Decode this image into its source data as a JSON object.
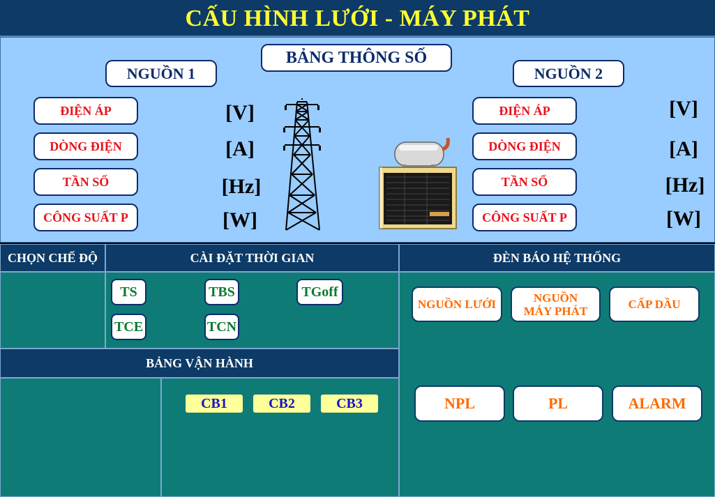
{
  "title": "CẤU HÌNH LƯỚI - MÁY PHÁT",
  "params": {
    "header": "BẢNG THÔNG SỐ",
    "source1": {
      "label": "NGUỒN 1",
      "rows": [
        {
          "name": "ĐIỆN ÁP",
          "unit": "[V]"
        },
        {
          "name": "DÒNG ĐIỆN",
          "unit": "[A]"
        },
        {
          "name": "TẦN SỐ",
          "unit": "[Hz]"
        },
        {
          "name": "CÔNG SUẤT P",
          "unit": "[W]"
        }
      ]
    },
    "source2": {
      "label": "NGUỒN 2",
      "rows": [
        {
          "name": "ĐIỆN ÁP",
          "unit": "[V]"
        },
        {
          "name": "DÒNG ĐIỆN",
          "unit": "[A]"
        },
        {
          "name": "TẦN SỐ",
          "unit": "[Hz]"
        },
        {
          "name": "CÔNG SUẤT P",
          "unit": "[W]"
        }
      ]
    },
    "icons": [
      "transmission-tower-icon",
      "generator-icon"
    ]
  },
  "mode": {
    "header": "CHỌN CHẾ ĐỘ"
  },
  "time_settings": {
    "header": "CÀI ĐẶT THỜI GIAN",
    "buttons": [
      "TS",
      "TBS",
      "TGoff",
      "TCE",
      "TCN"
    ]
  },
  "operation": {
    "header": "BẢNG VẬN HÀNH",
    "breakers": [
      "CB1",
      "CB2",
      "CB3"
    ]
  },
  "indicators": {
    "header": "ĐÈN BÁO HỆ THỐNG",
    "row1": [
      {
        "line1": "NGUỒN LƯỚI",
        "line2": ""
      },
      {
        "line1": "NGUỒN",
        "line2": "MÁY PHÁT"
      },
      {
        "line1": "CẤP DẦU",
        "line2": ""
      }
    ],
    "row2": [
      "NPL",
      "PL",
      "ALARM"
    ]
  },
  "colors": {
    "navy": "#0d3a66",
    "teal": "#0f7b77",
    "panel": "#99ccff",
    "title": "#ffff33",
    "alert_text": "#e8121a",
    "indicator_text": "#ff6a00",
    "breaker_bg": "#ffff99"
  }
}
